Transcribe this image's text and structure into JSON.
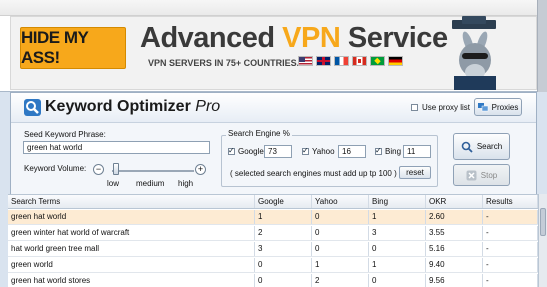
{
  "ad": {
    "logo": "HIDE MY ASS!",
    "title_prefix": "Advanced ",
    "title_highlight": "VPN",
    "title_suffix": " Service",
    "subtitle": "VPN SERVERS IN 75+ COUNTRIES...",
    "flags": [
      "us-flag",
      "uk-flag",
      "france-flag",
      "canada-flag",
      "brazil-flag",
      "germany-flag"
    ]
  },
  "app": {
    "title": "Keyword Optimizer",
    "title_suffix": "Pro",
    "proxy_list_label": "Use proxy list",
    "proxies_button": "Proxies",
    "seed_label": "Seed Keyword Phrase:",
    "seed_value": "green hat world",
    "volume_label": "Keyword Volume:",
    "volume_ticks": [
      "low",
      "medium",
      "high"
    ],
    "volume_minus": "−",
    "volume_plus": "+",
    "volume_level": 0.05,
    "engine_group_label": "Search Engine %",
    "engines": [
      {
        "name": "Google",
        "value": "73",
        "checked": true
      },
      {
        "name": "Yahoo",
        "value": "16",
        "checked": true
      },
      {
        "name": "Bing",
        "value": "11",
        "checked": true
      }
    ],
    "engine_note": "( selected search engines must add up tp 100 )",
    "reset_button": "reset",
    "search_button": "Search",
    "stop_button": "Stop"
  },
  "table": {
    "columns": [
      "Search Terms",
      "Google",
      "Yahoo",
      "Bing",
      "OKR",
      "Results"
    ],
    "rows": [
      [
        "green hat world",
        "1",
        "0",
        "1",
        "2.60",
        "-"
      ],
      [
        "green winter hat world of warcraft",
        "2",
        "0",
        "3",
        "3.55",
        "-"
      ],
      [
        "hat world green tree mall",
        "3",
        "0",
        "0",
        "5.16",
        "-"
      ],
      [
        "green world",
        "0",
        "1",
        "1",
        "9.40",
        "-"
      ],
      [
        "green hat world stores",
        "0",
        "2",
        "0",
        "9.56",
        "-"
      ]
    ]
  },
  "colors": {
    "accent_orange": "#f7a81b",
    "selected_row": "#fdebd3",
    "panel_border": "#9fb0c4"
  }
}
